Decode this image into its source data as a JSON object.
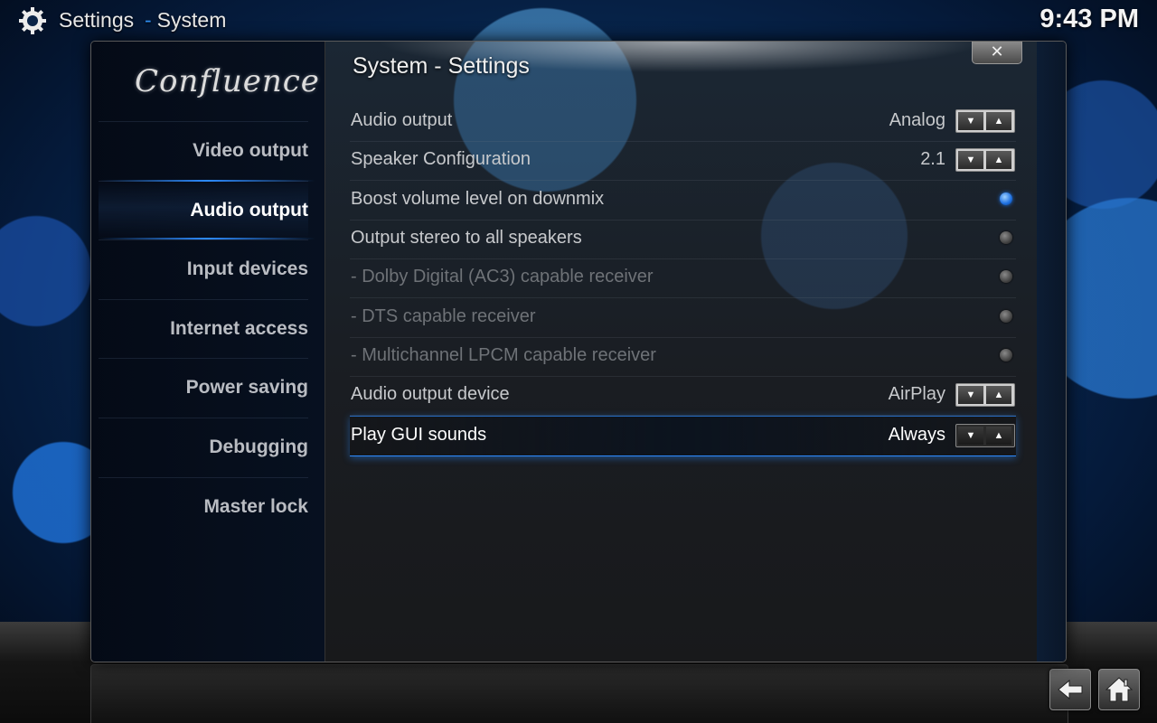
{
  "header": {
    "section": "Settings",
    "separator": "-",
    "page": "System",
    "clock": "9:43 PM"
  },
  "dialog": {
    "logo_text": "Confluence",
    "title": "System - Settings",
    "close_label": "✕"
  },
  "sidebar": {
    "items": [
      {
        "label": "Video output",
        "active": false
      },
      {
        "label": "Audio output",
        "active": true
      },
      {
        "label": "Input devices",
        "active": false
      },
      {
        "label": "Internet access",
        "active": false
      },
      {
        "label": "Power saving",
        "active": false
      },
      {
        "label": "Debugging",
        "active": false
      },
      {
        "label": "Master lock",
        "active": false
      }
    ]
  },
  "settings": [
    {
      "label": "Audio output",
      "type": "spinner",
      "value": "Analog",
      "disabled": false,
      "focused": false
    },
    {
      "label": "Speaker Configuration",
      "type": "spinner",
      "value": "2.1",
      "disabled": false,
      "focused": false
    },
    {
      "label": "Boost volume level on downmix",
      "type": "toggle",
      "on": true,
      "disabled": false,
      "focused": false
    },
    {
      "label": "Output stereo to all speakers",
      "type": "toggle",
      "on": false,
      "disabled": false,
      "focused": false
    },
    {
      "label": "- Dolby Digital (AC3) capable receiver",
      "type": "toggle",
      "on": false,
      "disabled": true,
      "focused": false
    },
    {
      "label": "- DTS capable receiver",
      "type": "toggle",
      "on": false,
      "disabled": true,
      "focused": false
    },
    {
      "label": "- Multichannel LPCM capable receiver",
      "type": "toggle",
      "on": false,
      "disabled": true,
      "focused": false
    },
    {
      "label": "Audio output device",
      "type": "spinner",
      "value": "AirPlay",
      "disabled": false,
      "focused": false
    },
    {
      "label": "Play GUI sounds",
      "type": "spinner",
      "value": "Always",
      "disabled": false,
      "focused": true
    }
  ],
  "spinner_glyphs": {
    "down": "▼",
    "up": "▲"
  },
  "icons": {
    "header": "gear-icon",
    "back": "back-arrow-icon",
    "home": "home-icon"
  },
  "colors": {
    "accent": "#2d8bff",
    "toggle_on": "#1d6fe0"
  }
}
